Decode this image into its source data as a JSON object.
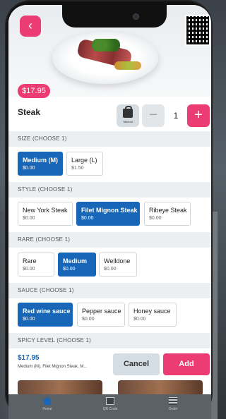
{
  "product": {
    "name": "Steak",
    "price_tag": "$17.95",
    "takeout_label": "Takeout",
    "quantity": "1",
    "minus_symbol": "−",
    "plus_symbol": "+",
    "back_symbol": "‹"
  },
  "sections": {
    "size": {
      "header": "SIZE (CHOOSE 1)",
      "options": [
        {
          "name": "Medium (M)",
          "price": "$0.00",
          "selected": true
        },
        {
          "name": "Large (L)",
          "price": "$1.50",
          "selected": false
        }
      ]
    },
    "style": {
      "header": "STYLE (CHOOSE 1)",
      "options": [
        {
          "name": "New York Steak",
          "price": "$0.00",
          "selected": false
        },
        {
          "name": "Filet Mignon Steak",
          "price": "$0.00",
          "selected": true
        },
        {
          "name": "Ribeye Steak",
          "price": "$0.00",
          "selected": false
        }
      ]
    },
    "rare": {
      "header": "RARE (CHOOSE 1)",
      "options": [
        {
          "name": "Rare",
          "price": "$0.00",
          "selected": false
        },
        {
          "name": "Medium",
          "price": "$0.00",
          "selected": true
        },
        {
          "name": "Welldone",
          "price": "$0.00",
          "selected": false
        }
      ]
    },
    "sauce": {
      "header": "SAUCE (CHOOSE 1)",
      "options": [
        {
          "name": "Red wine sauce",
          "price": "$0.00",
          "selected": true
        },
        {
          "name": "Pepper sauce",
          "price": "$0.00",
          "selected": false
        },
        {
          "name": "Honey sauce",
          "price": "$0.00",
          "selected": false
        }
      ]
    },
    "spicy": {
      "header": "SPICY LEVEL (CHOOSE 1)"
    }
  },
  "footer": {
    "total": "$17.95",
    "summary": "Medium (M), Filet Mignon Steak, M...",
    "cancel_label": "Cancel",
    "add_label": "Add"
  },
  "tabbar": {
    "tabs": [
      {
        "label": "Home",
        "icon": "home-icon"
      },
      {
        "label": "QR Code",
        "icon": "qr-code-icon"
      },
      {
        "label": "Order",
        "icon": "order-icon"
      }
    ]
  },
  "colors": {
    "accent_pink": "#ec3c74",
    "selected_blue": "#1766b8",
    "section_bg": "#eceff1"
  }
}
